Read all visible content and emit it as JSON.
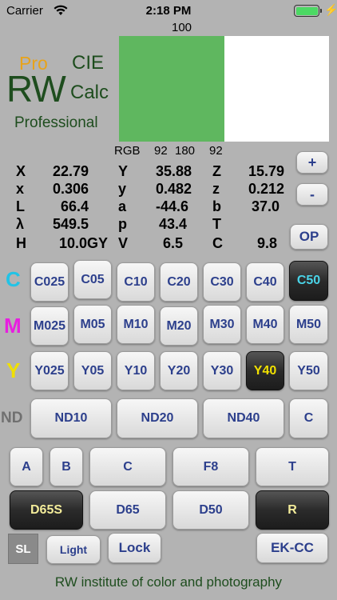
{
  "status": {
    "carrier": "Carrier",
    "time": "2:18 PM",
    "battery_level": 1.0
  },
  "display_percent": "100",
  "logo": {
    "pro": "Pro",
    "cie": "CIE",
    "rw": "RW",
    "calc": "Calc",
    "professional": "Professional"
  },
  "swatch": {
    "left_color": "#5fb75f",
    "right_color": "#ffffff"
  },
  "rgb": {
    "label": "RGB",
    "r": "92",
    "g": "180",
    "b": "92"
  },
  "readings": {
    "X": {
      "label": "X",
      "value": "22.79"
    },
    "Y": {
      "label": "Y",
      "value": "35.88"
    },
    "Z": {
      "label": "Z",
      "value": "15.79"
    },
    "x": {
      "label": "x",
      "value": "0.306"
    },
    "y": {
      "label": "y",
      "value": "0.482"
    },
    "z": {
      "label": "z",
      "value": "0.212"
    },
    "L": {
      "label": "L",
      "value": "66.4"
    },
    "a": {
      "label": "a",
      "value": "-44.6"
    },
    "b": {
      "label": "b",
      "value": "37.0"
    },
    "lambda": {
      "label": "λ",
      "value": "549.5"
    },
    "p": {
      "label": "p",
      "value": "43.4"
    },
    "T": {
      "label": "T",
      "value": ""
    },
    "H": {
      "label": "H",
      "value": "10.0GY"
    },
    "V": {
      "label": "V",
      "value": "6.5"
    },
    "C": {
      "label": "C",
      "value": "9.8"
    }
  },
  "side_buttons": {
    "plus": "+",
    "minus": "-",
    "op": "OP"
  },
  "filters": {
    "c_label": "C",
    "c_color": "#22c3e6",
    "m_label": "M",
    "m_color": "#e81ee0",
    "y_label": "Y",
    "y_color": "#f0e000",
    "nd_label": "ND",
    "nd_color": "#707070",
    "cyan": [
      "C025",
      "C05",
      "C10",
      "C20",
      "C30",
      "C40",
      "C50"
    ],
    "magenta": [
      "M025",
      "M05",
      "M10",
      "M20",
      "M30",
      "M40",
      "M50"
    ],
    "yellow": [
      "Y025",
      "Y05",
      "Y10",
      "Y20",
      "Y30",
      "Y40",
      "Y50"
    ],
    "nd": [
      "ND10",
      "ND20",
      "ND40",
      "C"
    ],
    "active_cyan": "C50",
    "active_yellow": "Y40",
    "active_cyan_text": "#4ad4e8",
    "active_yellow_text": "#f0e000"
  },
  "illuminant_row1": [
    "A",
    "B",
    "C",
    "F8",
    "T"
  ],
  "illuminant_row2": [
    "D65S",
    "D65",
    "D50",
    "R"
  ],
  "illuminant_active_text": "#f3ec9a",
  "bottom": {
    "sl": "SL",
    "light": "Light",
    "lock": "Lock",
    "ekcc": "EK-CC"
  },
  "footer": "RW institute of color and photography"
}
